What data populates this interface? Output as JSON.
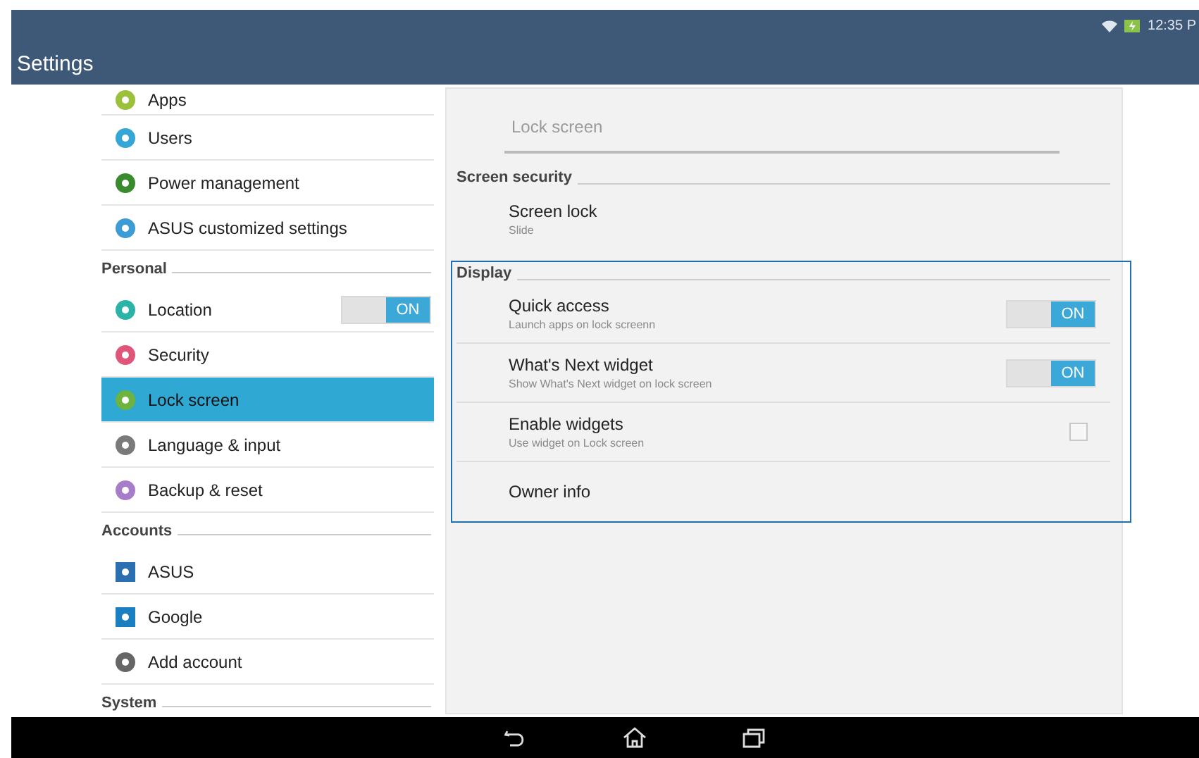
{
  "status_bar": {
    "time": "12:35 P"
  },
  "app_bar": {
    "title": "Settings"
  },
  "sidebar": {
    "items": [
      {
        "kind": "item",
        "label": "Apps",
        "color": "#9bc13c",
        "selected": false
      },
      {
        "kind": "item",
        "label": "Users",
        "color": "#35a6d6",
        "selected": false
      },
      {
        "kind": "item",
        "label": "Power management",
        "color": "#3a8a2e",
        "selected": false
      },
      {
        "kind": "item",
        "label": "ASUS customized settings",
        "color": "#3d9bd6",
        "selected": false
      },
      {
        "kind": "header",
        "label": "Personal"
      },
      {
        "kind": "item",
        "label": "Location",
        "color": "#2bb3a8",
        "selected": false,
        "toggle": {
          "on": true,
          "label": "ON"
        }
      },
      {
        "kind": "item",
        "label": "Security",
        "color": "#e0557a",
        "selected": false
      },
      {
        "kind": "item",
        "label": "Lock screen",
        "color": "#6cb33f",
        "selected": true
      },
      {
        "kind": "item",
        "label": "Language & input",
        "color": "#7a7a7a",
        "selected": false
      },
      {
        "kind": "item",
        "label": "Backup & reset",
        "color": "#a77cc9",
        "selected": false
      },
      {
        "kind": "header",
        "label": "Accounts"
      },
      {
        "kind": "account",
        "label": "ASUS",
        "color": "#2a6fb0",
        "selected": false
      },
      {
        "kind": "account",
        "label": "Google",
        "color": "#1a7fc1",
        "selected": false
      },
      {
        "kind": "item",
        "label": "Add account",
        "color": "#666666",
        "selected": false
      },
      {
        "kind": "header",
        "label": "System"
      }
    ]
  },
  "detail": {
    "title": "Lock screen",
    "sections": [
      {
        "header": "Screen security",
        "highlighted": false,
        "items": [
          {
            "kind": "plain",
            "title": "Screen lock",
            "subtitle": "Slide"
          }
        ]
      },
      {
        "header": "Display",
        "highlighted": true,
        "items": [
          {
            "kind": "toggle",
            "title": "Quick access",
            "subtitle": "Launch apps on lock screenn",
            "on": true,
            "toggle_label": "ON"
          },
          {
            "kind": "toggle",
            "title": "What's Next widget",
            "subtitle": "Show What's Next widget on lock screen",
            "on": true,
            "toggle_label": "ON"
          },
          {
            "kind": "checkbox",
            "title": "Enable widgets",
            "subtitle": "Use widget on Lock screen",
            "checked": false
          },
          {
            "kind": "plain",
            "title": "Owner info"
          }
        ]
      }
    ]
  }
}
